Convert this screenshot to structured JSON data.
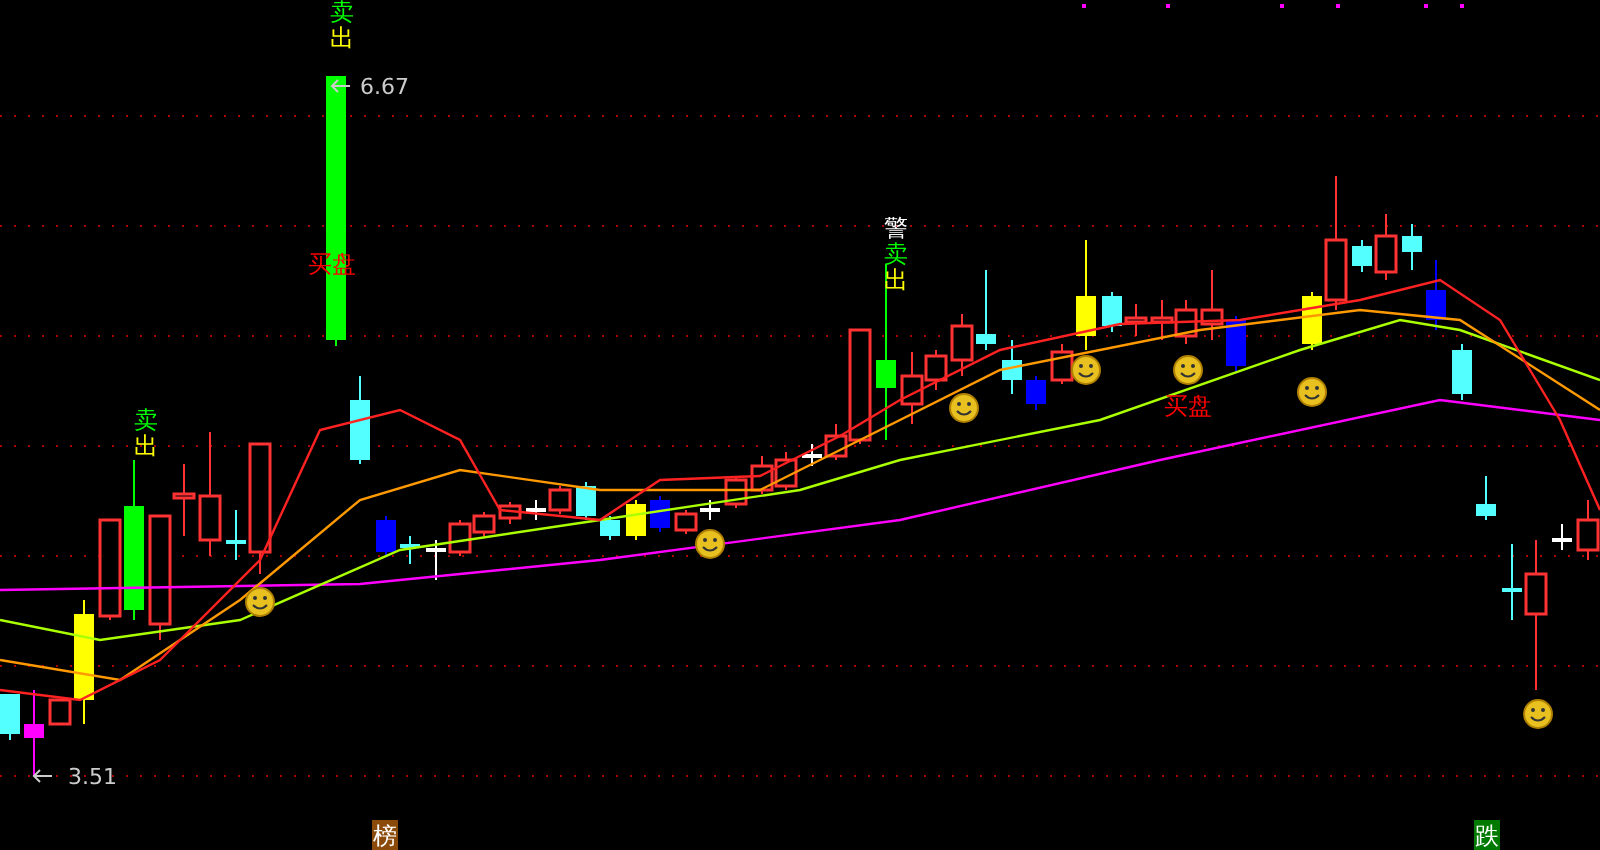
{
  "price_markers": [
    {
      "label": "6.67"
    },
    {
      "label": "3.51"
    }
  ],
  "signals": [
    {
      "parts": [
        {
          "text": "卖",
          "color": "#00ff00"
        },
        {
          "text": "出",
          "color": "#ffff00"
        }
      ]
    },
    {
      "parts": [
        {
          "text": "卖",
          "color": "#00ff00"
        },
        {
          "text": "出",
          "color": "#ffff00"
        }
      ]
    },
    {
      "parts": [
        {
          "text": "警",
          "color": "#ffffff"
        },
        {
          "text": "卖",
          "color": "#00ff00"
        },
        {
          "text": "出",
          "color": "#ffff00"
        }
      ]
    },
    {
      "parts": [
        {
          "text": "买盘",
          "color": "#ff0000"
        }
      ]
    },
    {
      "parts": [
        {
          "text": "买盘",
          "color": "#ff0000"
        }
      ]
    }
  ],
  "bottom_tags": [
    {
      "text": "榜",
      "color": "#8b4a0a"
    },
    {
      "text": "跌",
      "color": "#007a00"
    }
  ]
}
